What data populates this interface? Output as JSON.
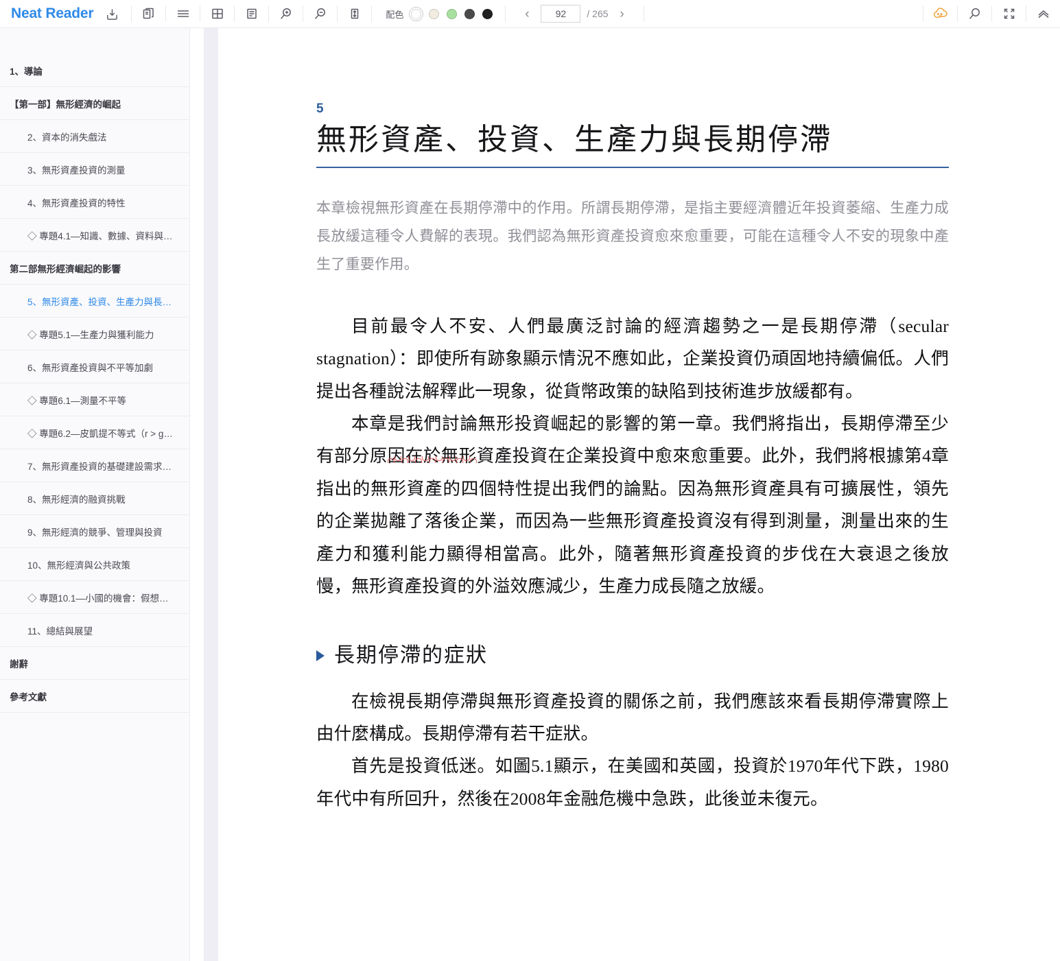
{
  "toolbar": {
    "brand": "Neat Reader",
    "icons": {
      "save_library": "save-to-library-icon",
      "copy": "copy-pages-icon",
      "menu": "hamburger-menu-icon",
      "grid": "grid-layout-icon",
      "text_layout": "text-layout-icon",
      "zoom_in": "zoom-in-icon",
      "zoom_out": "zoom-out-icon",
      "line_height": "line-height-icon",
      "cloud": "cloud-sync-icon",
      "search": "search-icon",
      "fullscreen": "fullscreen-icon",
      "collapse": "collapse-up-icon"
    },
    "scheme": {
      "label": "配色",
      "swatches": [
        "#ffffff",
        "#f2ece0",
        "#a8e0a0",
        "#4a4a4a",
        "#222222"
      ],
      "selected_index": 0
    },
    "pager": {
      "prev": "‹",
      "next": "›",
      "current": "92",
      "total_label": "/ 265"
    }
  },
  "sidebar": {
    "items": [
      {
        "label": "1、導論",
        "level": 0,
        "active": false
      },
      {
        "label": "【第一部】無形經濟的崛起",
        "level": 0,
        "active": false
      },
      {
        "label": "2、資本的消失戲法",
        "level": 1,
        "active": false
      },
      {
        "label": "3、無形資產投資的測量",
        "level": 1,
        "active": false
      },
      {
        "label": "4、無形資產投資的特性",
        "level": 1,
        "active": false
      },
      {
        "label": "◇ 專題4.1—知識、數據、資料與…",
        "level": 2,
        "active": false
      },
      {
        "label": "第二部無形經濟崛起的影響",
        "level": 0,
        "active": false
      },
      {
        "label": "5、無形資產、投資、生產力與長…",
        "level": 1,
        "active": true
      },
      {
        "label": "◇ 專題5.1—生產力與獲利能力",
        "level": 2,
        "active": false
      },
      {
        "label": "6、無形資產投資與不平等加劇",
        "level": 1,
        "active": false
      },
      {
        "label": "◇ 專題6.1—測量不平等",
        "level": 2,
        "active": false
      },
      {
        "label": "◇ 專題6.2—皮凱提不等式（r > g…",
        "level": 2,
        "active": false
      },
      {
        "label": "7、無形資產投資的基礎建設需求…",
        "level": 1,
        "active": false
      },
      {
        "label": "8、無形經濟的融資挑戰",
        "level": 1,
        "active": false
      },
      {
        "label": "9、無形經濟的競爭、管理與投資",
        "level": 1,
        "active": false
      },
      {
        "label": "10、無形經濟與公共政策",
        "level": 1,
        "active": false
      },
      {
        "label": "◇ 專題10.1—小國的機會：假想國…",
        "level": 2,
        "active": false
      },
      {
        "label": "11、總結與展望",
        "level": 1,
        "active": false
      },
      {
        "label": "謝辭",
        "level": 0,
        "active": false
      },
      {
        "label": "參考文獻",
        "level": 0,
        "active": false
      }
    ]
  },
  "content": {
    "chapter_number": "5",
    "chapter_title": "無形資產、投資、生產力與長期停滯",
    "abstract": "本章檢視無形資產在長期停滯中的作用。所謂長期停滯，是指主要經濟體近年投資萎縮、生產力成長放緩這種令人費解的表現。我們認為無形資產投資愈來愈重要，可能在這種令人不安的現象中產生了重要作用。",
    "paragraph_1": "目前最令人不安、人們最廣泛討論的經濟趨勢之一是長期停滯（secular stagnation）：即使所有跡象顯示情況不應如此，企業投資仍頑固地持續偏低。人們提出各種說法解釋此一現象，從貨幣政策的缺陷到技術進步放緩都有。",
    "paragraph_2_a": "本章是我們討論無形投資崛起的影響的第一章。我們將指出，長期停滯至少有部分原",
    "paragraph_2_annotated": "因在於無形",
    "paragraph_2_b": "資產投資在企業投資中愈來愈重要。此外，我們將根據第4章指出的無形資產的四個特性提出我們的論點。因為無形資產具有可擴展性，領先的企業拋離了落後企業，而因為一些無形資產投資沒有得到測量，測量出來的生產力和獲利能力顯得相當高。此外，隨著無形資產投資的步伐在大衰退之後放慢，無形資產投資的外溢效應減少，生產力成長隨之放緩。",
    "section_heading": "長期停滯的症狀",
    "paragraph_3": "在檢視長期停滯與無形資產投資的關係之前，我們應該來看長期停滯實際上由什麼構成。長期停滯有若干症狀。",
    "paragraph_4": "首先是投資低迷。如圖5.1顯示，在美國和英國，投資於1970年代下跌，1980年代中有所回升，然後在2008年金融危機中急跌，此後並未復元。"
  }
}
